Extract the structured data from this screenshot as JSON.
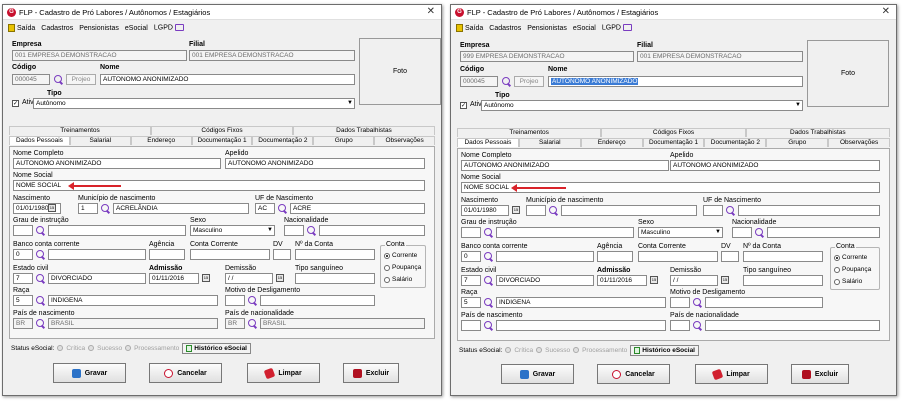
{
  "windows": [
    {
      "title": "FLP - Cadastro de Pró Labores / Autônomos / Estagiários",
      "empresa": "001 EMPRESA DEMONSTRACAO",
      "filial": "001 EMPRESA DEMONSTRACAO",
      "codigo": "000045",
      "nome": "AUTONOMO ANONIMIZADO",
      "tipo": "Autônomo",
      "nome_completo": "AUTONOMO ANONIMIZADO",
      "apelido": "AUTONOMO ANONIMIZADO",
      "nome_social": "NOME SOCIAL",
      "nascimento": "01/01/1980",
      "municipio_cod": "1",
      "municipio": "ACRELÂNDIA",
      "uf_cod": "AC",
      "uf": "ACRE",
      "grau": "",
      "sexo": "Masculino",
      "nacionalidade": "",
      "banco": "0",
      "estado_civil_cod": "7",
      "estado_civil": "DIVORCIADO",
      "admissao": "01/11/2016",
      "demissao": "/  /",
      "raca_cod": "5",
      "raca": "INDIGENA",
      "pais_nasc_cod": "BR",
      "pais_nasc": "BRASIL",
      "pais_nac_cod": "BR",
      "pais_nac": "BRASIL"
    },
    {
      "title": "FLP - Cadastro de Pró Labores / Autônomos / Estagiários",
      "empresa": "999 EMPRESA DEMONSTRACAO",
      "filial": "001 EMPRESA DEMONSTRACAO",
      "codigo": "000045",
      "nome": "AUTONOMO ANONIMIZADO",
      "tipo": "Autônomo",
      "nome_completo": "AUTONOMO ANONIMIZADO",
      "apelido": "AUTONOMO ANONIMIZADO",
      "nome_social": "NOME SOCIAL",
      "nascimento": "01/01/1980",
      "municipio_cod": "",
      "municipio": "",
      "uf_cod": "",
      "uf": "",
      "grau": "",
      "sexo": "Masculino",
      "nacionalidade": "",
      "banco": "0",
      "estado_civil_cod": "7",
      "estado_civil": "DIVORCIADO",
      "admissao": "01/11/2016",
      "demissao": "/  /",
      "raca_cod": "5",
      "raca": "INDIGENA",
      "pais_nasc_cod": "",
      "pais_nasc": "",
      "pais_nac_cod": "",
      "pais_nac": ""
    }
  ],
  "labels": {
    "menu_saida": "Saída",
    "menu_cadastros": "Cadastros",
    "menu_pensionistas": "Pensionistas",
    "menu_esocial": "eSocial",
    "menu_lgpd": "LGPD",
    "empresa": "Empresa",
    "filial": "Filial",
    "codigo": "Código",
    "nome": "Nome",
    "projeo": "Projeo",
    "foto": "Foto",
    "ativo": "Ativo",
    "tipo": "Tipo",
    "tabs_top": [
      "Treinamentos",
      "Códigos Fixos",
      "Dados Trabalhistas"
    ],
    "tabs_bottom": [
      "Dados Pessoais",
      "Salarial",
      "Endereço",
      "Documentação 1",
      "Documentação 2",
      "Grupo",
      "Observações"
    ],
    "nome_completo": "Nome Completo",
    "apelido": "Apelido",
    "nome_social": "Nome Social",
    "nascimento": "Nascimento",
    "municipio": "Município de nascimento",
    "uf": "UF de Nascimento",
    "grau": "Grau de instrução",
    "sexo": "Sexo",
    "nacionalidade": "Nacionalidade",
    "banco": "Banco conta corrente",
    "agencia": "Agência",
    "conta_corrente": "Conta Corrente",
    "dv": "DV",
    "n_conta": "Nº da Conta",
    "conta": "Conta",
    "corrente": "Corrente",
    "poupanca": "Poupança",
    "salario": "Salário",
    "estado_civil": "Estado civil",
    "admissao": "Admissão",
    "demissao": "Demissão",
    "tipo_sang": "Tipo sanguíneo",
    "motivo": "Motivo de Desligamento",
    "raca": "Raça",
    "pais_nasc": "País de nascimento",
    "pais_nac": "País de nacionalidade",
    "status_esocial": "Status eSocial:",
    "critica": "Crítica",
    "sucesso": "Sucesso",
    "processamento": "Processamento",
    "historico": "Histórico eSocial",
    "gravar": "Gravar",
    "cancelar": "Cancelar",
    "limpar": "Limpar",
    "excluir": "Excluir"
  },
  "colors": {
    "arrow": "#d9232a",
    "accent": "#7a3cc0",
    "selection": "#3a7bd5"
  }
}
